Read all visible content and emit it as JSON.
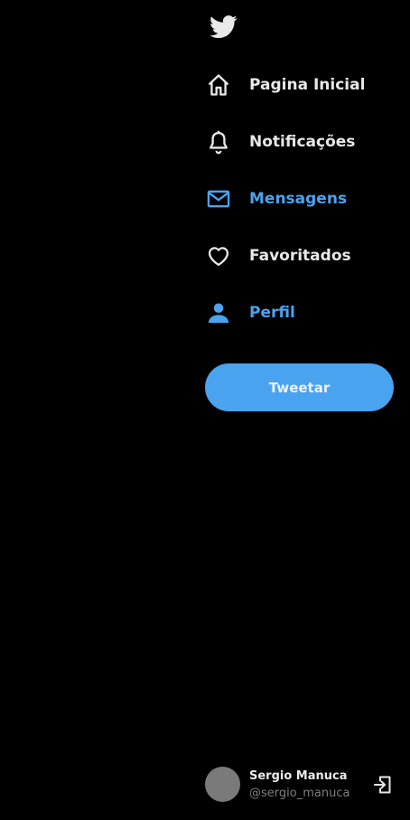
{
  "colors": {
    "background": "#000000",
    "accent": "#4aa3ef",
    "text": "#e8e8e8",
    "muted": "#7e7e7e",
    "avatar": "#7a7a7a"
  },
  "logo": {
    "icon": "twitter-bird-icon"
  },
  "nav": {
    "items": [
      {
        "label": "Pagina Inicial",
        "icon": "home-icon",
        "active": false
      },
      {
        "label": "Notificações",
        "icon": "bell-icon",
        "active": false
      },
      {
        "label": "Mensagens",
        "icon": "mail-icon",
        "active": true
      },
      {
        "label": "Favoritados",
        "icon": "heart-icon",
        "active": false
      },
      {
        "label": "Perfil",
        "icon": "user-icon",
        "active": true
      }
    ]
  },
  "tweet_button": {
    "label": "Tweetar"
  },
  "profile": {
    "name": "Sergio Manuca",
    "handle": "@sergio_manuca",
    "logout_icon": "logout-icon"
  }
}
